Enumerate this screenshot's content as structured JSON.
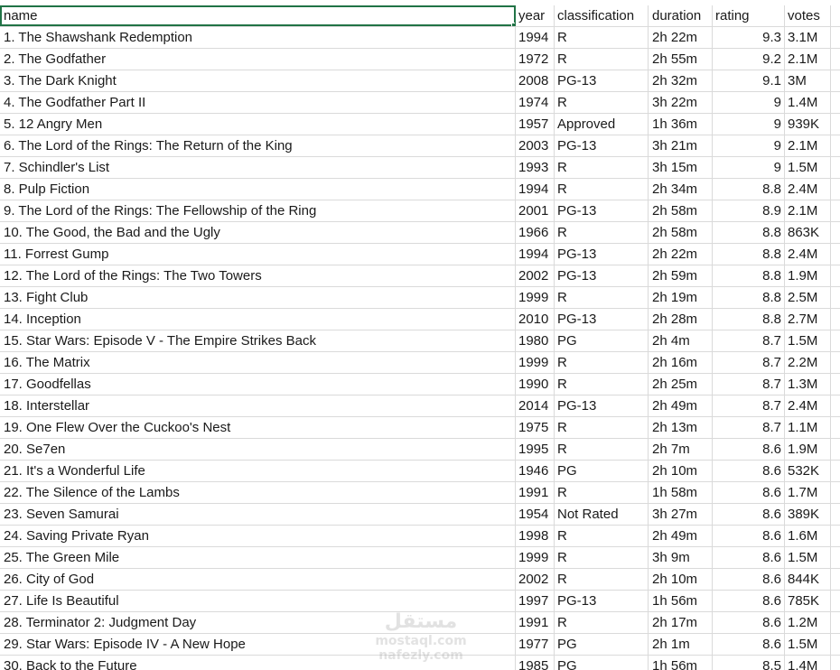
{
  "header": {
    "name": "name",
    "year": "year",
    "classification": "classification",
    "duration": "duration",
    "rating": "rating",
    "votes": "votes"
  },
  "rows": [
    {
      "name": "1. The Shawshank Redemption",
      "year": "1994",
      "classification": "R",
      "duration": "2h 22m",
      "rating": "9.3",
      "votes": "3.1M"
    },
    {
      "name": "2. The Godfather",
      "year": "1972",
      "classification": "R",
      "duration": "2h 55m",
      "rating": "9.2",
      "votes": "2.1M"
    },
    {
      "name": "3. The Dark Knight",
      "year": "2008",
      "classification": "PG-13",
      "duration": "2h 32m",
      "rating": "9.1",
      "votes": "3M"
    },
    {
      "name": "4. The Godfather Part II",
      "year": "1974",
      "classification": "R",
      "duration": "3h 22m",
      "rating": "9",
      "votes": "1.4M"
    },
    {
      "name": "5. 12 Angry Men",
      "year": "1957",
      "classification": "Approved",
      "duration": "1h 36m",
      "rating": "9",
      "votes": "939K"
    },
    {
      "name": "6. The Lord of the Rings: The Return of the King",
      "year": "2003",
      "classification": "PG-13",
      "duration": "3h 21m",
      "rating": "9",
      "votes": "2.1M"
    },
    {
      "name": "7. Schindler's List",
      "year": "1993",
      "classification": "R",
      "duration": "3h 15m",
      "rating": "9",
      "votes": "1.5M"
    },
    {
      "name": "8. Pulp Fiction",
      "year": "1994",
      "classification": "R",
      "duration": "2h 34m",
      "rating": "8.8",
      "votes": "2.4M"
    },
    {
      "name": "9. The Lord of the Rings: The Fellowship of the Ring",
      "year": "2001",
      "classification": "PG-13",
      "duration": "2h 58m",
      "rating": "8.9",
      "votes": "2.1M"
    },
    {
      "name": "10. The Good, the Bad and the Ugly",
      "year": "1966",
      "classification": "R",
      "duration": "2h 58m",
      "rating": "8.8",
      "votes": "863K"
    },
    {
      "name": "11. Forrest Gump",
      "year": "1994",
      "classification": "PG-13",
      "duration": "2h 22m",
      "rating": "8.8",
      "votes": "2.4M"
    },
    {
      "name": "12. The Lord of the Rings: The Two Towers",
      "year": "2002",
      "classification": "PG-13",
      "duration": "2h 59m",
      "rating": "8.8",
      "votes": "1.9M"
    },
    {
      "name": "13. Fight Club",
      "year": "1999",
      "classification": "R",
      "duration": "2h 19m",
      "rating": "8.8",
      "votes": "2.5M"
    },
    {
      "name": "14. Inception",
      "year": "2010",
      "classification": "PG-13",
      "duration": "2h 28m",
      "rating": "8.8",
      "votes": "2.7M"
    },
    {
      "name": "15. Star Wars: Episode V - The Empire Strikes Back",
      "year": "1980",
      "classification": "PG",
      "duration": "2h 4m",
      "rating": "8.7",
      "votes": "1.5M"
    },
    {
      "name": "16. The Matrix",
      "year": "1999",
      "classification": "R",
      "duration": "2h 16m",
      "rating": "8.7",
      "votes": "2.2M"
    },
    {
      "name": "17. Goodfellas",
      "year": "1990",
      "classification": "R",
      "duration": "2h 25m",
      "rating": "8.7",
      "votes": "1.3M"
    },
    {
      "name": "18. Interstellar",
      "year": "2014",
      "classification": "PG-13",
      "duration": "2h 49m",
      "rating": "8.7",
      "votes": "2.4M"
    },
    {
      "name": "19. One Flew Over the Cuckoo's Nest",
      "year": "1975",
      "classification": "R",
      "duration": "2h 13m",
      "rating": "8.7",
      "votes": "1.1M"
    },
    {
      "name": "20. Se7en",
      "year": "1995",
      "classification": "R",
      "duration": "2h 7m",
      "rating": "8.6",
      "votes": "1.9M"
    },
    {
      "name": "21. It's a Wonderful Life",
      "year": "1946",
      "classification": "PG",
      "duration": "2h 10m",
      "rating": "8.6",
      "votes": "532K"
    },
    {
      "name": "22. The Silence of the Lambs",
      "year": "1991",
      "classification": "R",
      "duration": "1h 58m",
      "rating": "8.6",
      "votes": "1.7M"
    },
    {
      "name": "23. Seven Samurai",
      "year": "1954",
      "classification": "Not Rated",
      "duration": "3h 27m",
      "rating": "8.6",
      "votes": "389K"
    },
    {
      "name": "24. Saving Private Ryan",
      "year": "1998",
      "classification": "R",
      "duration": "2h 49m",
      "rating": "8.6",
      "votes": "1.6M"
    },
    {
      "name": "25. The Green Mile",
      "year": "1999",
      "classification": "R",
      "duration": "3h 9m",
      "rating": "8.6",
      "votes": "1.5M"
    },
    {
      "name": "26. City of God",
      "year": "2002",
      "classification": "R",
      "duration": "2h 10m",
      "rating": "8.6",
      "votes": "844K"
    },
    {
      "name": "27. Life Is Beautiful",
      "year": "1997",
      "classification": "PG-13",
      "duration": "1h 56m",
      "rating": "8.6",
      "votes": "785K"
    },
    {
      "name": "28. Terminator 2: Judgment Day",
      "year": "1991",
      "classification": "R",
      "duration": "2h 17m",
      "rating": "8.6",
      "votes": "1.2M"
    },
    {
      "name": "29. Star Wars: Episode IV - A New Hope",
      "year": "1977",
      "classification": "PG",
      "duration": "2h 1m",
      "rating": "8.6",
      "votes": "1.5M"
    },
    {
      "name": "30. Back to the Future",
      "year": "1985",
      "classification": "PG",
      "duration": "1h 56m",
      "rating": "8.5",
      "votes": "1.4M"
    }
  ],
  "watermark": {
    "logo": "مستقل",
    "line1": "mostaql.com",
    "line2": "nafezly.com"
  }
}
